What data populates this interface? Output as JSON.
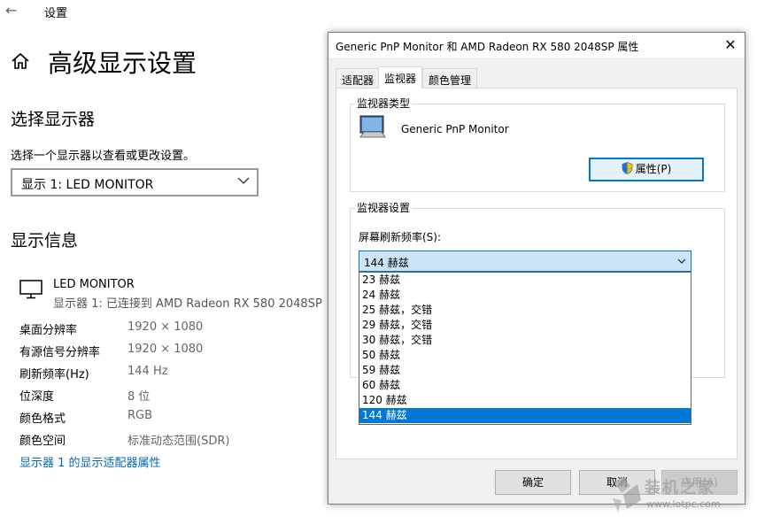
{
  "window": {
    "title": "设置",
    "back_icon": "back-arrow-icon"
  },
  "page": {
    "title": "高级显示设置",
    "home_icon": "home-icon"
  },
  "select_display": {
    "heading": "选择显示器",
    "label": "选择一个显示器以查看或更改设置。",
    "selected": "显示 1: LED MONITOR"
  },
  "display_info": {
    "heading": "显示信息",
    "monitor_name": "LED MONITOR",
    "monitor_sub": "显示器 1: 已连接到 AMD Radeon RX 580 2048SP",
    "rows": [
      {
        "key": "桌面分辨率",
        "value": "1920 × 1080"
      },
      {
        "key": "有源信号分辨率",
        "value": "1920 × 1080"
      },
      {
        "key": "刷新频率(Hz)",
        "value": "144 Hz"
      },
      {
        "key": "位深度",
        "value": "8 位"
      },
      {
        "key": "颜色格式",
        "value": "RGB"
      },
      {
        "key": "颜色空间",
        "value": "标准动态范围(SDR)"
      }
    ],
    "adapter_link": "显示器 1 的显示适配器属性"
  },
  "dialog": {
    "title": "Generic PnP Monitor 和 AMD Radeon RX 580 2048SP 属性",
    "tabs": [
      "适配器",
      "监视器",
      "颜色管理"
    ],
    "active_tab": 1,
    "monitor_type": {
      "label": "监视器类型",
      "name": "Generic PnP Monitor",
      "properties_button": "属性(P)"
    },
    "monitor_settings": {
      "label": "监视器设置",
      "refresh_label": "屏幕刷新频率(S):",
      "refresh_selected": "144 赫兹",
      "options": [
        "23 赫兹",
        "24 赫兹",
        "25 赫兹，交错",
        "29 赫兹，交错",
        "30 赫兹，交错",
        "50 赫兹",
        "59 赫兹",
        "60 赫兹",
        "120 赫兹",
        "144 赫兹"
      ],
      "selected_index": 9
    },
    "buttons": {
      "ok": "确定",
      "cancel": "取消",
      "apply": "应用(A)"
    }
  },
  "watermark": {
    "text": "装机之家",
    "url": "www.lotpc.com"
  },
  "colors": {
    "accent": "#0078d7",
    "link": "#0067b8"
  }
}
